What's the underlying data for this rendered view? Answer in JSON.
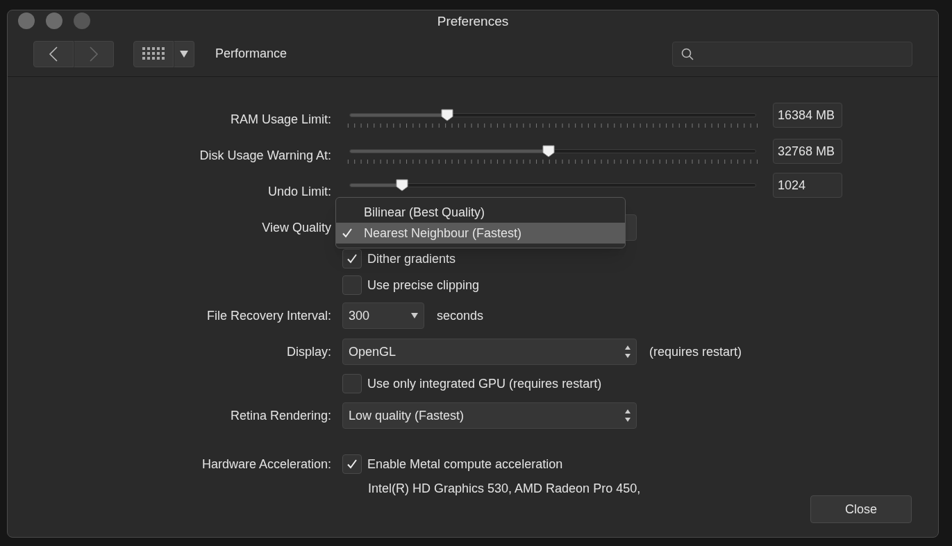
{
  "window": {
    "title": "Preferences"
  },
  "toolbar": {
    "section": "Performance"
  },
  "rows": [
    {
      "kind": "slider",
      "label": "RAM Usage Limit:",
      "level": 0.24,
      "value": "16384 MB",
      "ticks": true
    },
    {
      "kind": "slider",
      "label": "Disk Usage Warning At:",
      "level": 0.49,
      "value": "32768 MB",
      "ticks": true
    },
    {
      "kind": "slider",
      "label": "Undo Limit:",
      "level": 0.13,
      "value": "1024",
      "ticks": false
    },
    {
      "kind": "popup",
      "label": "View Quality",
      "options": [
        {
          "label": "Bilinear (Best Quality)",
          "selected": false
        },
        {
          "label": "Nearest Neighbour (Fastest)",
          "selected": true
        }
      ]
    },
    {
      "kind": "checkbox",
      "text": "Dither gradients",
      "checked": true
    },
    {
      "kind": "checkbox",
      "text": "Use precise clipping",
      "checked": false
    },
    {
      "kind": "combo",
      "label": "File Recovery Interval:",
      "value": "300",
      "suffix": "seconds"
    },
    {
      "kind": "select",
      "label": "Display:",
      "value": "OpenGL",
      "suffix": "(requires restart)"
    },
    {
      "kind": "checkbox",
      "text": "Use only integrated GPU (requires restart)",
      "checked": false
    },
    {
      "kind": "select",
      "label": "Retina Rendering:",
      "value": "Low quality (Fastest)"
    },
    {
      "kind": "checkbox",
      "label": "Hardware Acceleration:",
      "text": "Enable Metal compute acceleration",
      "checked": true
    },
    {
      "kind": "note",
      "text": "Intel(R) HD Graphics 530, AMD Radeon Pro 450,"
    }
  ],
  "close_button": "Close"
}
